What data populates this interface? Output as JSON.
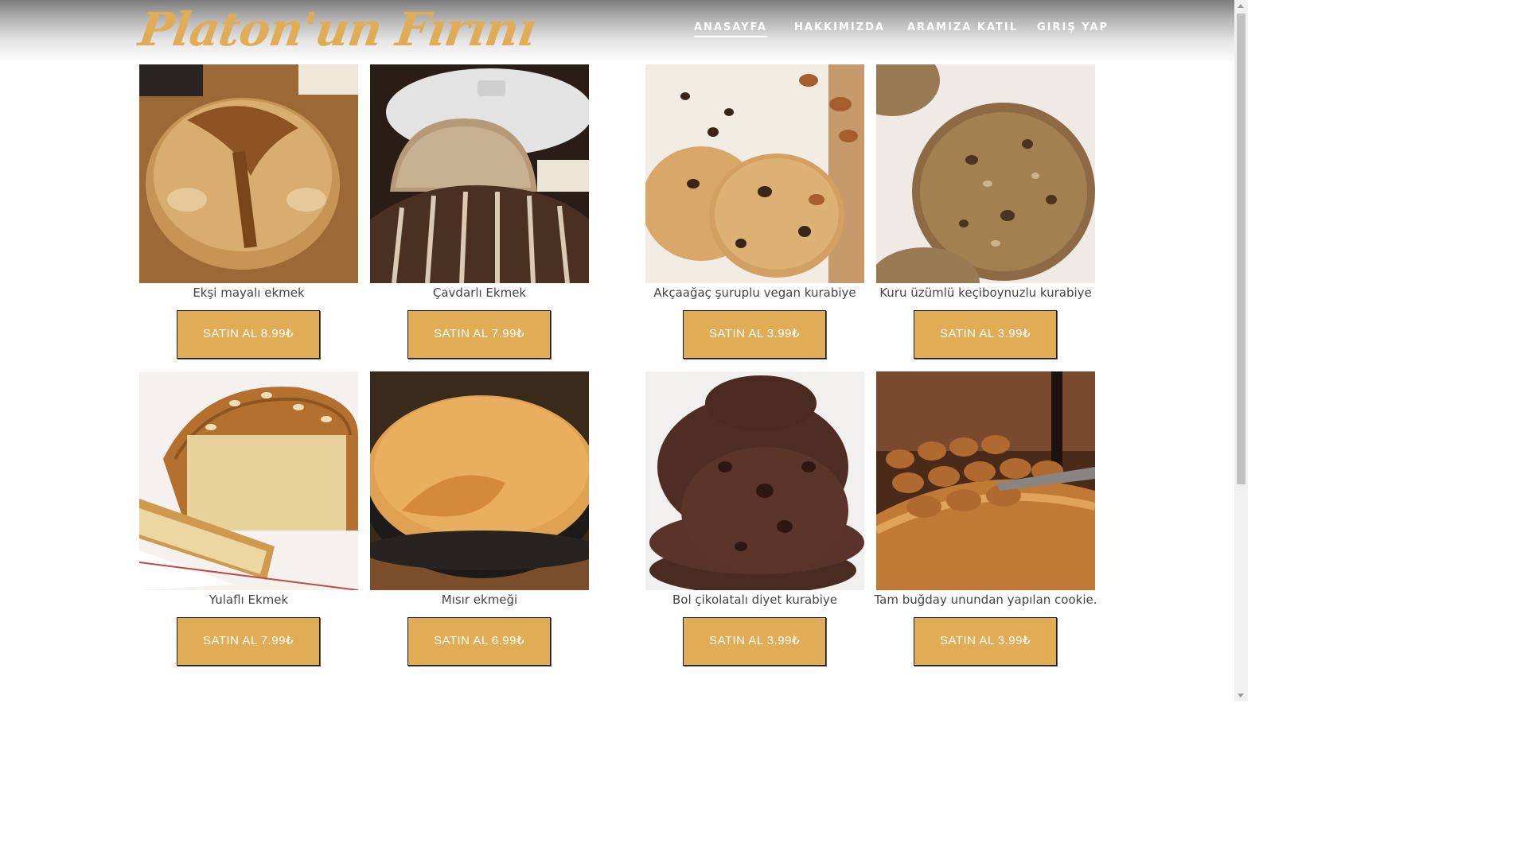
{
  "header": {
    "logo": "Platon'un Fırını",
    "nav": [
      {
        "label": "ANASAYFA",
        "active": true
      },
      {
        "label": "HAKKIMIZDA",
        "active": false
      },
      {
        "label": "ARAMIZA KATIL",
        "active": false
      },
      {
        "label": "GIRIŞ YAP",
        "active": false
      }
    ]
  },
  "colors": {
    "accent": "#e0ad56",
    "text": "#444444",
    "button_border": "#1b1b1b"
  },
  "products": [
    {
      "name": "Ekşi mayalı ekmek",
      "button": "SATIN AL 8.99₺",
      "image": "sourdough-bread-image"
    },
    {
      "name": "Çavdarlı Ekmek",
      "button": "SATIN AL 7.99₺",
      "image": "rye-bread-image"
    },
    {
      "name": "Akçaağaç şuruplu vegan kurabiye",
      "button": "SATIN AL 3.99₺",
      "image": "maple-pecan-cookie-image"
    },
    {
      "name": "Kuru üzümlü keçiboynuzlu kurabiye",
      "button": "SATIN AL 3.99₺",
      "image": "raisin-carob-cookie-image"
    },
    {
      "name": "Yulaflı Ekmek",
      "button": "SATIN AL 7.99₺",
      "image": "oat-bread-image"
    },
    {
      "name": "Mısır ekmeği",
      "button": "SATIN AL 6.99₺",
      "image": "cornbread-image"
    },
    {
      "name": "Bol çikolatalı diyet kurabiye",
      "button": "SATIN AL 3.99₺",
      "image": "double-chocolate-cookie-image"
    },
    {
      "name": "Tam buğday unundan yapılan cookie.",
      "button": "SATIN AL 3.99₺",
      "image": "whole-wheat-cookie-image"
    }
  ]
}
